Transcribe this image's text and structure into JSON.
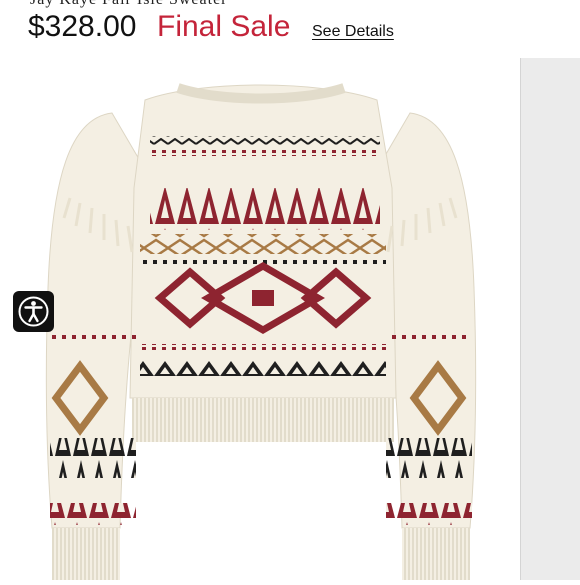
{
  "header": {
    "cut_title": "Jay Kaye Fair Isle Sweater",
    "price": "$328.00",
    "sale_label": "Final Sale",
    "details_link": "See Details"
  },
  "colors": {
    "sale_red": "#c4243a",
    "sweater_cream": "#f4efe3",
    "knit_burgundy": "#8e2430",
    "knit_camel": "#a87a45",
    "knit_black": "#1f1f1f"
  },
  "icons": {
    "accessibility": "accessibility-icon"
  }
}
